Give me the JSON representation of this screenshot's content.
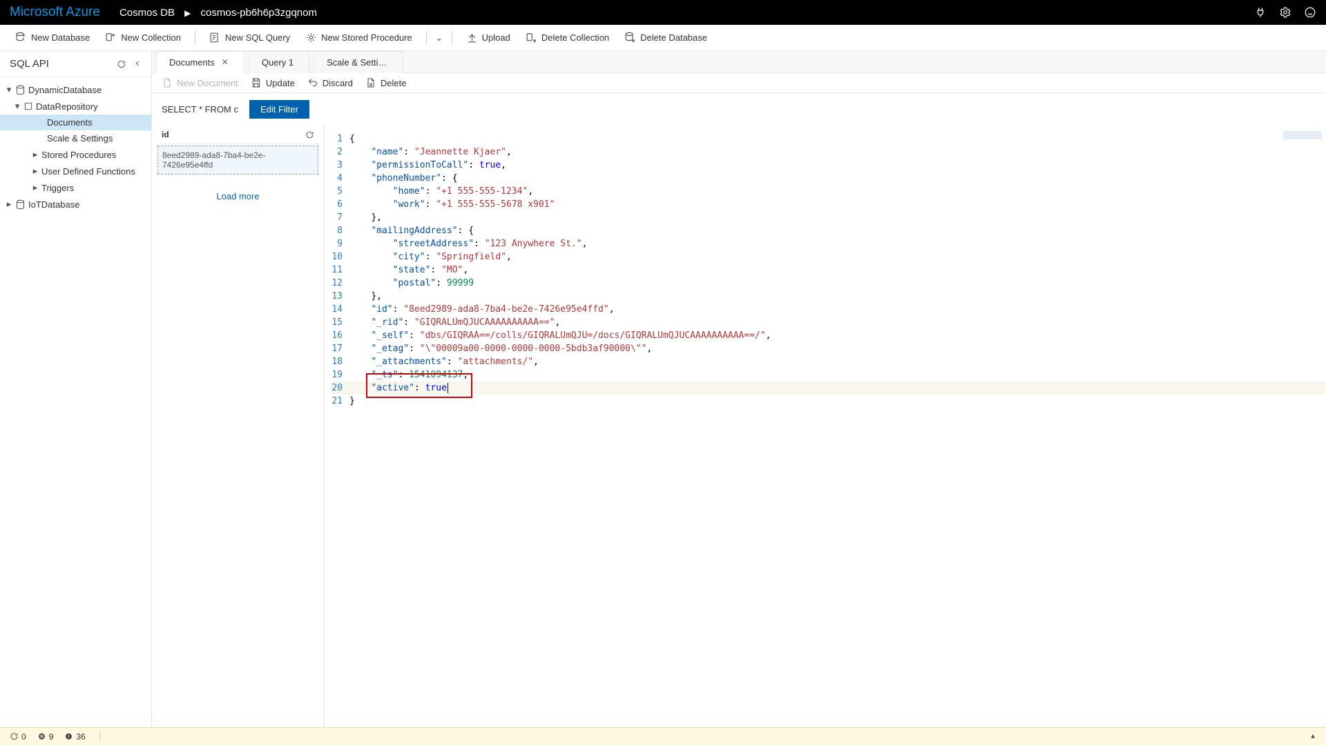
{
  "topbar": {
    "brand": "Microsoft Azure",
    "crumb1": "Cosmos DB",
    "crumb2": "cosmos-pb6h6p3zgqnom"
  },
  "toolbar": {
    "newDatabase": "New Database",
    "newCollection": "New Collection",
    "newSqlQuery": "New SQL Query",
    "newStoredProc": "New Stored Procedure",
    "upload": "Upload",
    "deleteCollection": "Delete Collection",
    "deleteDatabase": "Delete Database"
  },
  "sidebar": {
    "title": "SQL API",
    "nodes": {
      "db1": "DynamicDatabase",
      "coll1": "DataRepository",
      "documents": "Documents",
      "scale": "Scale & Settings",
      "sprocs": "Stored Procedures",
      "udfs": "User Defined Functions",
      "triggers": "Triggers",
      "db2": "IoTDatabase"
    }
  },
  "tabs": {
    "t0": "Documents",
    "t1": "Query 1",
    "t2": "Scale & Setti…"
  },
  "docToolbar": {
    "newDoc": "New Document",
    "update": "Update",
    "discard": "Discard",
    "delete": "Delete"
  },
  "filter": {
    "text": "SELECT * FROM c",
    "editBtn": "Edit Filter"
  },
  "docList": {
    "header": "id",
    "item0": "8eed2989-ada8-7ba4-be2e-7426e95e4ffd",
    "loadMore": "Load more"
  },
  "status": {
    "a": "0",
    "b": "9",
    "c": "36"
  },
  "docJson": {
    "name": "Jeannette Kjaer",
    "permissionToCall": true,
    "phoneNumber": {
      "home": "+1 555-555-1234",
      "work": "+1 555-555-5678 x901"
    },
    "mailingAddress": {
      "streetAddress": "123 Anywhere St.",
      "city": "Springfield",
      "state": "MO",
      "postal": 99999
    },
    "id": "8eed2989-ada8-7ba4-be2e-7426e95e4ffd",
    "_rid": "GIQRALUmQJUCAAAAAAAAAA==",
    "_self": "dbs/GIQRAA==/colls/GIQRALUmQJU=/docs/GIQRALUmQJUCAAAAAAAAAA==/",
    "_etag": "\"00009a00-0000-0000-0000-5bdb3af90000\"",
    "_attachments": "attachments/",
    "_ts": 1541094137,
    "active": true
  }
}
